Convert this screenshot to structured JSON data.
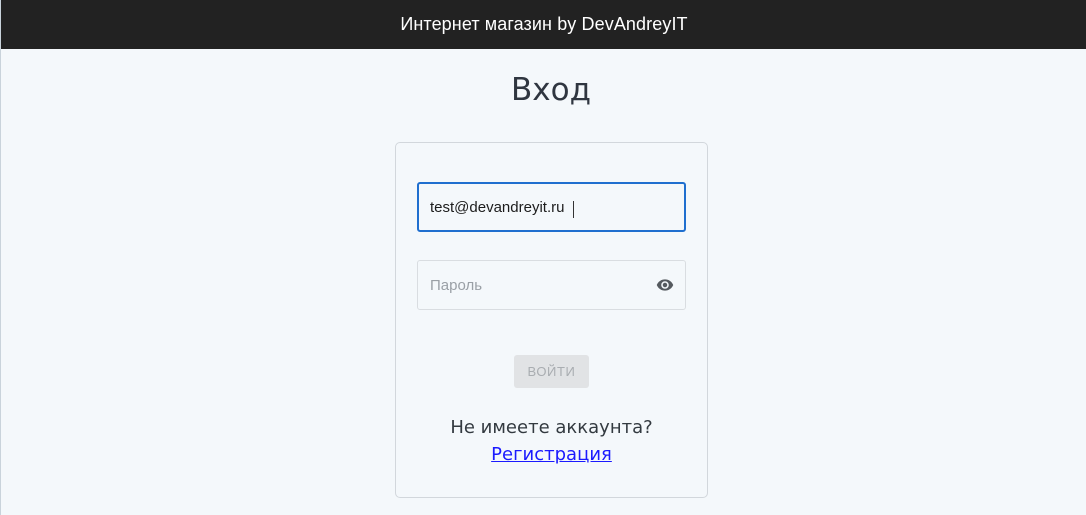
{
  "header": {
    "title": "Интернет магазин by DevAndreyIT"
  },
  "page": {
    "title": "Вход"
  },
  "form": {
    "email_value": "test@devandreyit.ru",
    "password_placeholder": "Пароль",
    "password_toggle_icon": "eye-icon",
    "submit_label": "ВОЙТИ",
    "no_account_text": "Не имеете аккаунта?",
    "register_link": "Регистрация"
  },
  "colors": {
    "header_bg": "#222222",
    "page_bg": "#f4f8fb",
    "focus_border": "#1f6fcf",
    "link": "#1a1aff"
  }
}
